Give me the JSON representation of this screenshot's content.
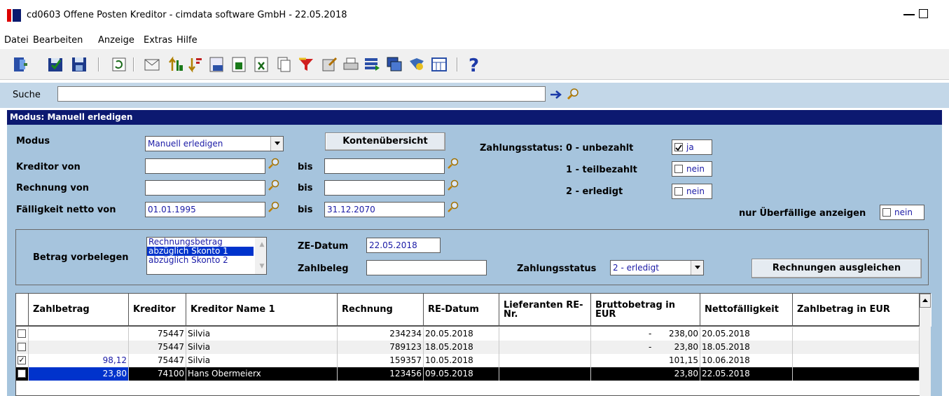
{
  "window": {
    "title": "cd0603 Offene Posten Kreditor - cimdata software GmbH - 22.05.2018"
  },
  "menu": [
    "Datei",
    "Bearbeiten",
    "Anzeige",
    "Extras",
    "Hilfe"
  ],
  "toolbar": {
    "icons": [
      "exit-icon",
      "save-check-icon",
      "save-icon",
      "refresh-icon",
      "mail-icon",
      "sort-ascending-icon",
      "sort-descending-icon",
      "calculator-icon",
      "export-icon",
      "excel-icon",
      "copy-icon",
      "filter-icon",
      "edit-icon",
      "print-icon",
      "list-icon",
      "window-icon",
      "book-icon",
      "table-icon",
      "help-icon"
    ]
  },
  "search": {
    "label": "Suche",
    "value": ""
  },
  "mode_header": "Modus: Manuell erledigen",
  "form": {
    "modus_label": "Modus",
    "modus_value": "Manuell erledigen",
    "kreditor_von_label": "Kreditor von",
    "rechnung_von_label": "Rechnung von",
    "faelligkeit_label": "Fälligkeit netto von",
    "bis": "bis",
    "kreditor_von": "",
    "kreditor_bis": "",
    "rechnung_von": "",
    "rechnung_bis": "",
    "faelligkeit_von": "01.01.1995",
    "faelligkeit_bis": "31.12.2070",
    "kontenuebersicht_button": "Kontenübersicht",
    "zahlungsstatus_label": "Zahlungsstatus:",
    "status_0": "0 - unbezahlt",
    "status_1": "1 - teilbezahlt",
    "status_2": "2 - erledigt",
    "status_0_value": "ja",
    "status_1_value": "nein",
    "status_2_value": "nein",
    "ueberfaellige_label": "nur Überfällige anzeigen",
    "ueberfaellige_value": "nein"
  },
  "sub": {
    "betrag_label": "Betrag vorbelegen",
    "betrag_options": [
      "Rechnungsbetrag",
      "abzüglich Skonto 1",
      "abzüglich Skonto 2"
    ],
    "betrag_selected": "abzüglich Skonto 1",
    "ze_datum_label": "ZE-Datum",
    "ze_datum_value": "22.05.2018",
    "zahlbeleg_label": "Zahlbeleg",
    "zahlbeleg_value": "",
    "zahlungsstatus_label": "Zahlungsstatus",
    "zahlungsstatus_value": "2 - erledigt",
    "ausgleichen_button": "Rechnungen ausgleichen"
  },
  "table": {
    "columns": [
      "Zahlbetrag",
      "Kreditor",
      "Kreditor Name 1",
      "Rechnung",
      "RE-Datum",
      "Lieferanten RE-Nr.",
      "Bruttobetrag in EUR",
      "Nettofälligkeit",
      "Zahlbetrag in EUR"
    ],
    "rows": [
      {
        "checked": false,
        "zahlbetrag": "",
        "kreditor": "75447",
        "name": "Silvia",
        "rechnung": "234234",
        "re_datum": "20.05.2018",
        "lief_re_nr": "",
        "brutto_mark": "-",
        "brutto": "238,00",
        "netto_faellig": "20.05.2018",
        "zahl_eur": ""
      },
      {
        "checked": false,
        "zahlbetrag": "",
        "kreditor": "75447",
        "name": "Silvia",
        "rechnung": "789123",
        "re_datum": "18.05.2018",
        "lief_re_nr": "",
        "brutto_mark": "-",
        "brutto": "23,80",
        "netto_faellig": "18.05.2018",
        "zahl_eur": ""
      },
      {
        "checked": true,
        "zahlbetrag": "98,12",
        "kreditor": "75447",
        "name": "Silvia",
        "rechnung": "159357",
        "re_datum": "10.05.2018",
        "lief_re_nr": "",
        "brutto_mark": "",
        "brutto": "101,15",
        "netto_faellig": "10.06.2018",
        "zahl_eur": ""
      },
      {
        "checked": true,
        "zahlbetrag": "23,80",
        "kreditor": "74100",
        "name": "Hans Obermeierx",
        "rechnung": "123456",
        "re_datum": "09.05.2018",
        "lief_re_nr": "",
        "brutto_mark": "",
        "brutto": "23,80",
        "netto_faellig": "22.05.2018",
        "zahl_eur": ""
      }
    ]
  },
  "colors": {
    "mode_bar": "#0c1970",
    "panel": "#a6c4dd",
    "search_bar": "#c3d7e8",
    "selected_row": "#000000",
    "selected_cell": "#0033cc",
    "value_text": "#1a1aa6"
  }
}
